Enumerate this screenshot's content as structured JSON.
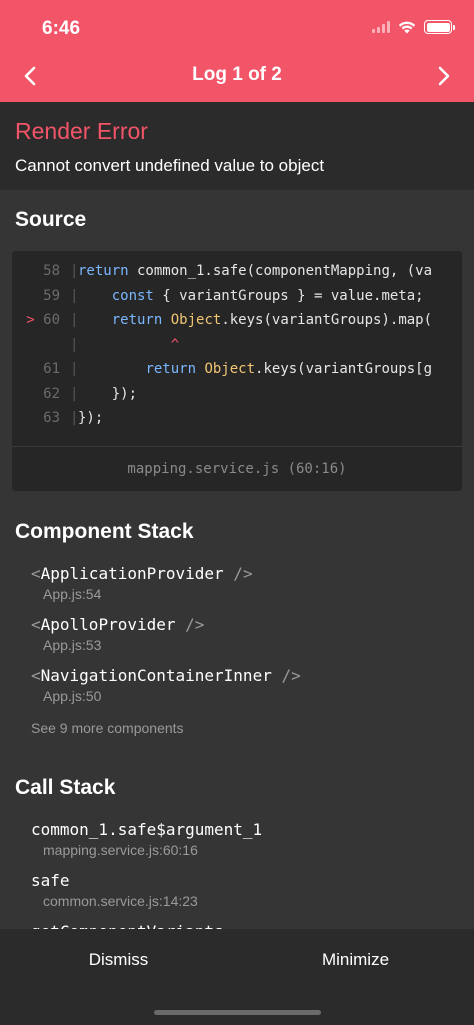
{
  "status_bar": {
    "time": "6:46"
  },
  "header": {
    "title": "Log 1 of 2",
    "prev_icon": "chevron-left",
    "next_icon": "chevron-right",
    "color": "#f25468"
  },
  "error": {
    "title": "Render Error",
    "message": "Cannot convert undefined value to object"
  },
  "source": {
    "heading": "Source",
    "lines": [
      {
        "num": "58",
        "marker": "",
        "code": "return common_1.safe(componentMapping, (va"
      },
      {
        "num": "59",
        "marker": "",
        "code": "    const { variantGroups } = value.meta;"
      },
      {
        "num": "60",
        "marker": ">",
        "code": "    return Object.keys(variantGroups).map("
      },
      {
        "num": "",
        "marker": "",
        "code": "           ^"
      },
      {
        "num": "61",
        "marker": "",
        "code": "        return Object.keys(variantGroups[g"
      },
      {
        "num": "62",
        "marker": "",
        "code": "    });"
      },
      {
        "num": "63",
        "marker": "",
        "code": "});"
      }
    ],
    "file": "mapping.service.js (60:16)"
  },
  "component_stack": {
    "heading": "Component Stack",
    "items": [
      {
        "name": "ApplicationProvider",
        "loc": "App.js:54"
      },
      {
        "name": "ApolloProvider",
        "loc": "App.js:53"
      },
      {
        "name": "NavigationContainerInner",
        "loc": "App.js:50"
      }
    ],
    "see_more": "See 9 more components"
  },
  "call_stack": {
    "heading": "Call Stack",
    "items": [
      {
        "name": "common_1.safe$argument_1",
        "loc": "mapping.service.js:60:16"
      },
      {
        "name": "safe",
        "loc": "common.service.js:14:23"
      },
      {
        "name": "getComponentVariants",
        "loc": ""
      }
    ]
  },
  "footer": {
    "dismiss": "Dismiss",
    "minimize": "Minimize"
  }
}
